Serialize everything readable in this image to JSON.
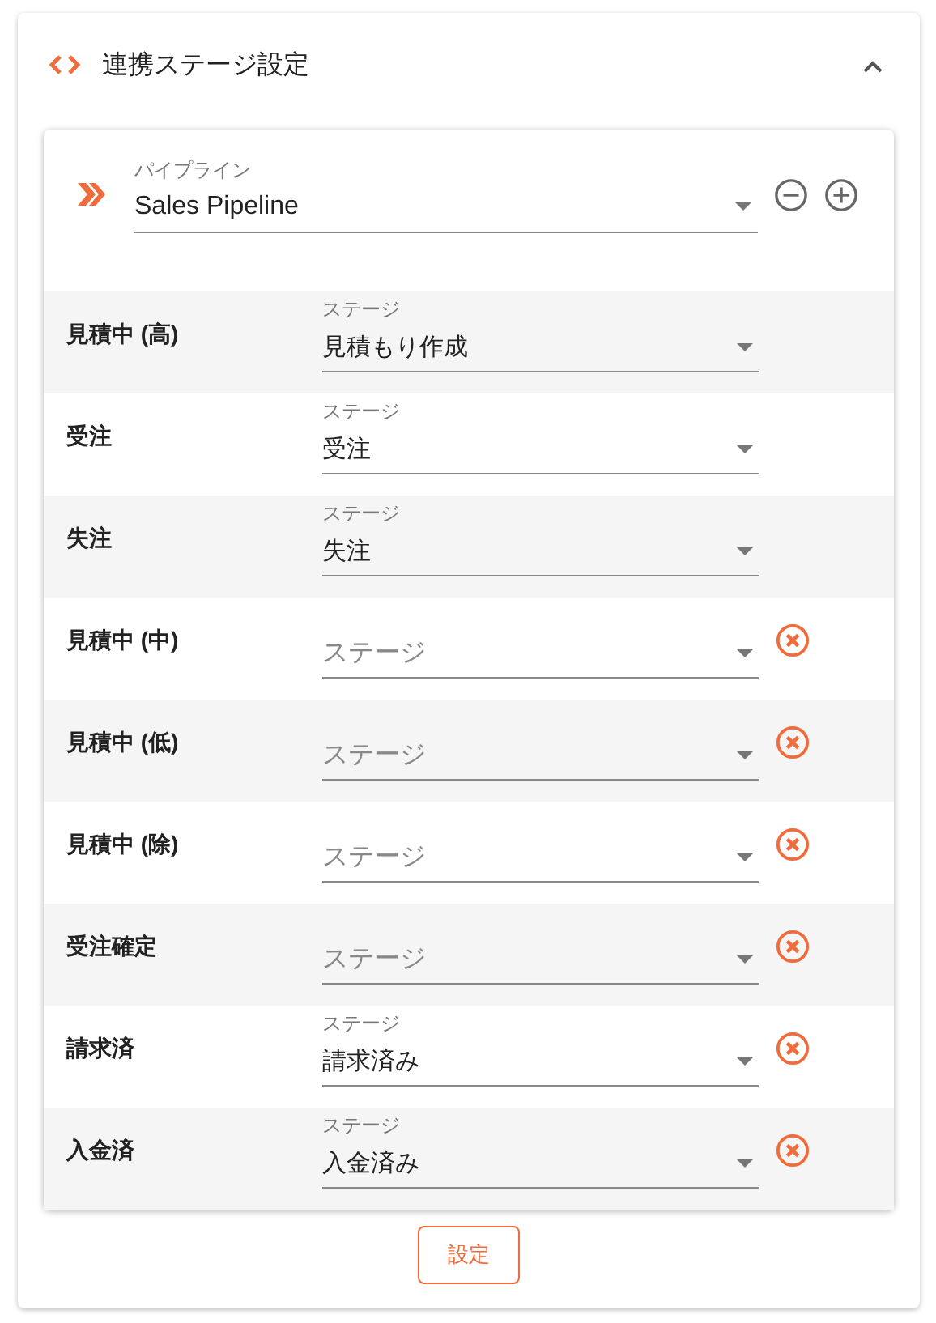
{
  "panel": {
    "title": "連携ステージ設定",
    "expanded": true
  },
  "pipeline": {
    "label": "パイプライン",
    "value": "Sales Pipeline"
  },
  "rows": [
    {
      "label": "見積中 (高)",
      "stage": {
        "label": "ステージ",
        "value": "見積もり作成"
      },
      "removable": false
    },
    {
      "label": "受注",
      "stage": {
        "label": "ステージ",
        "value": "受注"
      },
      "removable": false
    },
    {
      "label": "失注",
      "stage": {
        "label": "ステージ",
        "value": "失注"
      },
      "removable": false
    },
    {
      "label": "見積中 (中)",
      "stage": {
        "placeholder": "ステージ"
      },
      "removable": true
    },
    {
      "label": "見積中 (低)",
      "stage": {
        "placeholder": "ステージ"
      },
      "removable": true
    },
    {
      "label": "見積中 (除)",
      "stage": {
        "placeholder": "ステージ"
      },
      "removable": true
    },
    {
      "label": "受注確定",
      "stage": {
        "placeholder": "ステージ"
      },
      "removable": true
    },
    {
      "label": "請求済",
      "stage": {
        "label": "ステージ",
        "value": "請求済み"
      },
      "removable": true
    },
    {
      "label": "入金済",
      "stage": {
        "label": "ステージ",
        "value": "入金済み"
      },
      "removable": true
    }
  ],
  "submit": "設定"
}
